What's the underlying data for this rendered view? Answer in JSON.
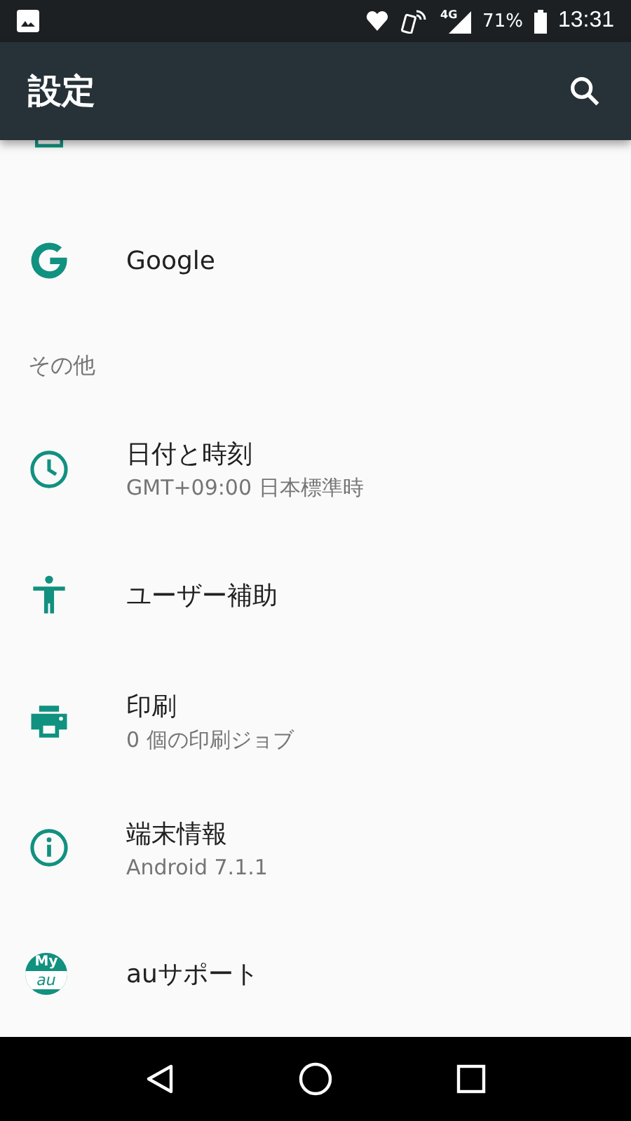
{
  "status_bar": {
    "network": "4G",
    "battery": "71%",
    "time": "13:31"
  },
  "app_bar": {
    "title": "設定"
  },
  "groups": [
    {
      "items": [
        {
          "kind": "google",
          "title": "Google"
        }
      ]
    },
    {
      "header": "その他",
      "items": [
        {
          "kind": "clock",
          "title": "日付と時刻",
          "subtitle": "GMT+09:00 日本標準時"
        },
        {
          "kind": "accessibility",
          "title": "ユーザー補助"
        },
        {
          "kind": "print",
          "title": "印刷",
          "subtitle": "0 個の印刷ジョブ"
        },
        {
          "kind": "info",
          "title": "端末情報",
          "subtitle": "Android 7.1.1"
        },
        {
          "kind": "logo",
          "title": "auサポート",
          "logo_top": "My",
          "logo_bottom": "au"
        }
      ]
    }
  ]
}
